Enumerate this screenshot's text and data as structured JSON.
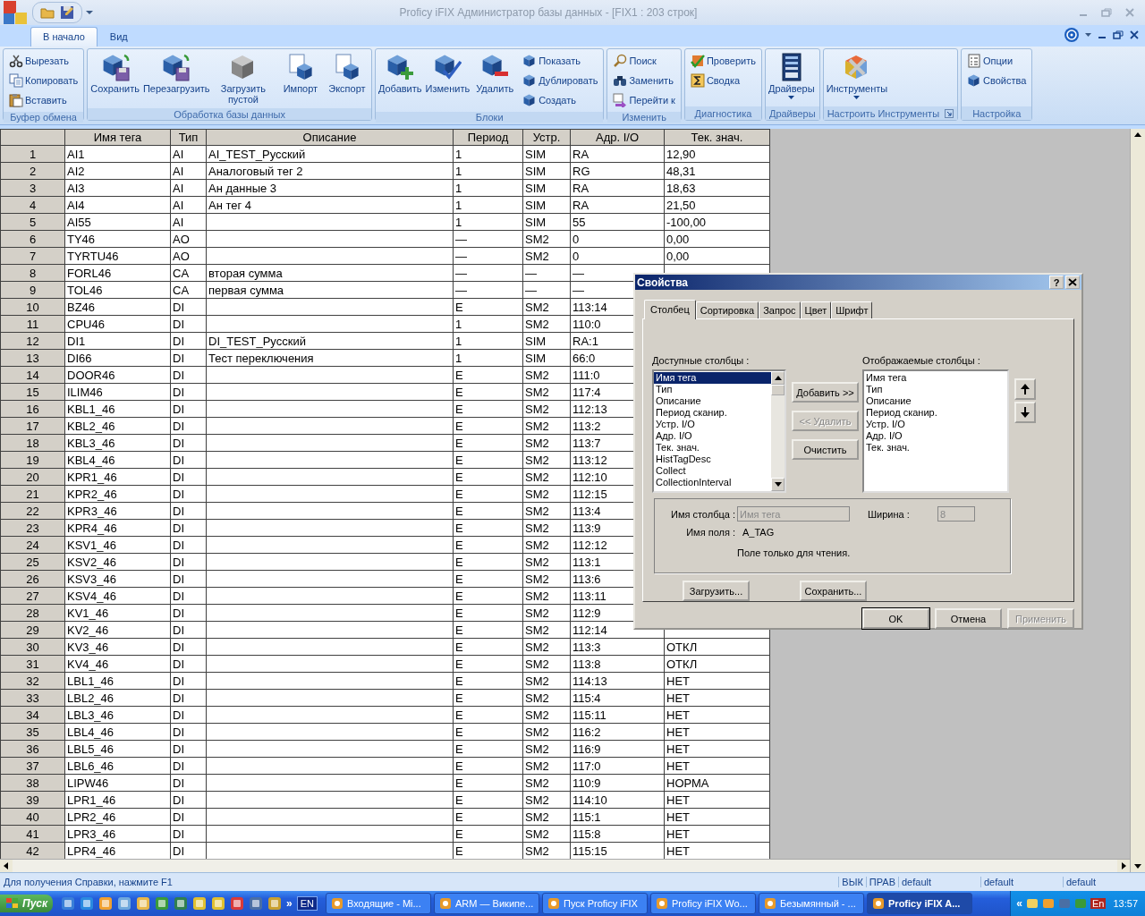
{
  "window": {
    "title": "Proficy iFIX Администратор базы данных - [FIX1 : 203 строк]"
  },
  "ribbon_tabs": [
    {
      "label": "В начало",
      "selected": true
    },
    {
      "label": "Вид",
      "selected": false
    }
  ],
  "ribbon": {
    "groups": [
      {
        "label": "Буфер обмена",
        "launcher": false,
        "items": [
          {
            "label": "Вырезать",
            "kind": "small"
          },
          {
            "label": "Копировать",
            "kind": "small"
          },
          {
            "label": "Вставить",
            "kind": "small"
          }
        ]
      },
      {
        "label": "Обработка базы данных",
        "launcher": false,
        "items": [
          {
            "label": "Сохранить",
            "kind": "large"
          },
          {
            "label": "Перезагрузить",
            "kind": "large"
          },
          {
            "label": "Загрузить пустой",
            "kind": "large"
          },
          {
            "label": "Импорт",
            "kind": "large"
          },
          {
            "label": "Экспорт",
            "kind": "large"
          }
        ]
      },
      {
        "label": "Блоки",
        "launcher": false,
        "items": [
          {
            "label": "Добавить",
            "kind": "large"
          },
          {
            "label": "Изменить",
            "kind": "large"
          },
          {
            "label": "Удалить",
            "kind": "large"
          },
          {
            "label": "Показать",
            "kind": "small"
          },
          {
            "label": "Дублировать",
            "kind": "small"
          },
          {
            "label": "Создать",
            "kind": "small"
          }
        ]
      },
      {
        "label": "Изменить",
        "launcher": false,
        "items": [
          {
            "label": "Поиск",
            "kind": "small"
          },
          {
            "label": "Заменить",
            "kind": "small"
          },
          {
            "label": "Перейти к",
            "kind": "small"
          }
        ]
      },
      {
        "label": "Диагностика",
        "launcher": false,
        "items": [
          {
            "label": "Проверить",
            "kind": "small"
          },
          {
            "label": "Сводка",
            "kind": "small"
          }
        ]
      },
      {
        "label": "Драйверы",
        "launcher": false,
        "items": [
          {
            "label": "Драйверы",
            "kind": "large_menu"
          }
        ]
      },
      {
        "label": "Настроить Инструменты",
        "launcher": true,
        "items": [
          {
            "label": "Инструменты",
            "kind": "large_menu"
          }
        ]
      },
      {
        "label": "Настройка",
        "launcher": false,
        "items": [
          {
            "label": "Опции",
            "kind": "small"
          },
          {
            "label": "Свойства",
            "kind": "small"
          }
        ]
      }
    ]
  },
  "table": {
    "columns": [
      "",
      "Имя тега",
      "Тип",
      "Описание",
      "Период",
      "Устр.",
      "Адр. I/O",
      "Тек. знач."
    ],
    "rows": [
      [
        "1",
        "AI1",
        "AI",
        "AI_TEST_Русский",
        "1",
        "SIM",
        "RA",
        "12,90"
      ],
      [
        "2",
        "AI2",
        "AI",
        "Аналоговый тег 2",
        "1",
        "SIM",
        "RG",
        "48,31"
      ],
      [
        "3",
        "AI3",
        "AI",
        "Ан данные 3",
        "1",
        "SIM",
        "RA",
        "18,63"
      ],
      [
        "4",
        "AI4",
        "AI",
        "Ан тег 4",
        "1",
        "SIM",
        "RA",
        "21,50"
      ],
      [
        "5",
        "AI55",
        "AI",
        "",
        "1",
        "SIM",
        "55",
        "-100,00"
      ],
      [
        "6",
        "TY46",
        "AO",
        "",
        "—",
        "SM2",
        "0",
        "0,00"
      ],
      [
        "7",
        "TYRTU46",
        "AO",
        "",
        "—",
        "SM2",
        "0",
        "0,00"
      ],
      [
        "8",
        "FORL46",
        "CA",
        "вторая сумма",
        "—",
        "—",
        "—"
      ],
      [
        "9",
        "TOL46",
        "CA",
        "первая сумма",
        "—",
        "—",
        "—"
      ],
      [
        "10",
        "BZ46",
        "DI",
        "",
        "E",
        "SM2",
        "113:14"
      ],
      [
        "11",
        "CPU46",
        "DI",
        "",
        "1",
        "SM2",
        "110:0"
      ],
      [
        "12",
        "DI1",
        "DI",
        "DI_TEST_Русский",
        "1",
        "SIM",
        "RA:1"
      ],
      [
        "13",
        "DI66",
        "DI",
        "Тест переключения",
        "1",
        "SIM",
        "66:0"
      ],
      [
        "14",
        "DOOR46",
        "DI",
        "",
        "E",
        "SM2",
        "111:0"
      ],
      [
        "15",
        "ILIM46",
        "DI",
        "",
        "E",
        "SM2",
        "117:4"
      ],
      [
        "16",
        "KBL1_46",
        "DI",
        "",
        "E",
        "SM2",
        "112:13"
      ],
      [
        "17",
        "KBL2_46",
        "DI",
        "",
        "E",
        "SM2",
        "113:2"
      ],
      [
        "18",
        "KBL3_46",
        "DI",
        "",
        "E",
        "SM2",
        "113:7"
      ],
      [
        "19",
        "KBL4_46",
        "DI",
        "",
        "E",
        "SM2",
        "113:12"
      ],
      [
        "20",
        "KPR1_46",
        "DI",
        "",
        "E",
        "SM2",
        "112:10"
      ],
      [
        "21",
        "KPR2_46",
        "DI",
        "",
        "E",
        "SM2",
        "112:15"
      ],
      [
        "22",
        "KPR3_46",
        "DI",
        "",
        "E",
        "SM2",
        "113:4"
      ],
      [
        "23",
        "KPR4_46",
        "DI",
        "",
        "E",
        "SM2",
        "113:9"
      ],
      [
        "24",
        "KSV1_46",
        "DI",
        "",
        "E",
        "SM2",
        "112:12"
      ],
      [
        "25",
        "KSV2_46",
        "DI",
        "",
        "E",
        "SM2",
        "113:1"
      ],
      [
        "26",
        "KSV3_46",
        "DI",
        "",
        "E",
        "SM2",
        "113:6"
      ],
      [
        "27",
        "KSV4_46",
        "DI",
        "",
        "E",
        "SM2",
        "113:11"
      ],
      [
        "28",
        "KV1_46",
        "DI",
        "",
        "E",
        "SM2",
        "112:9"
      ],
      [
        "29",
        "KV2_46",
        "DI",
        "",
        "E",
        "SM2",
        "112:14"
      ],
      [
        "30",
        "KV3_46",
        "DI",
        "",
        "E",
        "SM2",
        "113:3",
        "ОТКЛ"
      ],
      [
        "31",
        "KV4_46",
        "DI",
        "",
        "E",
        "SM2",
        "113:8",
        "ОТКЛ"
      ],
      [
        "32",
        "LBL1_46",
        "DI",
        "",
        "E",
        "SM2",
        "114:13",
        "НЕТ"
      ],
      [
        "33",
        "LBL2_46",
        "DI",
        "",
        "E",
        "SM2",
        "115:4",
        "НЕТ"
      ],
      [
        "34",
        "LBL3_46",
        "DI",
        "",
        "E",
        "SM2",
        "115:11",
        "НЕТ"
      ],
      [
        "35",
        "LBL4_46",
        "DI",
        "",
        "E",
        "SM2",
        "116:2",
        "НЕТ"
      ],
      [
        "36",
        "LBL5_46",
        "DI",
        "",
        "E",
        "SM2",
        "116:9",
        "НЕТ"
      ],
      [
        "37",
        "LBL6_46",
        "DI",
        "",
        "E",
        "SM2",
        "117:0",
        "НЕТ"
      ],
      [
        "38",
        "LIPW46",
        "DI",
        "",
        "E",
        "SM2",
        "110:9",
        "НОРМА"
      ],
      [
        "39",
        "LPR1_46",
        "DI",
        "",
        "E",
        "SM2",
        "114:10",
        "НЕТ"
      ],
      [
        "40",
        "LPR2_46",
        "DI",
        "",
        "E",
        "SM2",
        "115:1",
        "НЕТ"
      ],
      [
        "41",
        "LPR3_46",
        "DI",
        "",
        "E",
        "SM2",
        "115:8",
        "НЕТ"
      ],
      [
        "42",
        "LPR4_46",
        "DI",
        "",
        "E",
        "SM2",
        "115:15",
        "НЕТ"
      ]
    ]
  },
  "dialog": {
    "title": "Свойства",
    "help": "?",
    "tabs": [
      {
        "label": "Столбец",
        "selected": true
      },
      {
        "label": "Сортировка",
        "selected": false
      },
      {
        "label": "Запрос",
        "selected": false
      },
      {
        "label": "Цвет",
        "selected": false
      },
      {
        "label": "Шрифт",
        "selected": false
      }
    ],
    "available_label": "Доступные столбцы :",
    "available_items": [
      {
        "label": "Имя тега",
        "selected": true
      },
      {
        "label": "Тип",
        "selected": false
      },
      {
        "label": "Описание",
        "selected": false
      },
      {
        "label": "Период сканир.",
        "selected": false
      },
      {
        "label": "Устр. I/O",
        "selected": false
      },
      {
        "label": "Адр. I/O",
        "selected": false
      },
      {
        "label": "Тек. знач.",
        "selected": false
      },
      {
        "label": "HistTagDesc",
        "selected": false
      },
      {
        "label": "Collect",
        "selected": false
      },
      {
        "label": "CollectionInterval",
        "selected": false
      }
    ],
    "move_buttons": [
      {
        "label": "Добавить >>",
        "disabled": false
      },
      {
        "label": "<< Удалить",
        "disabled": true
      },
      {
        "label": "Очистить",
        "disabled": false
      }
    ],
    "displayed_label": "Отображаемые столбцы :",
    "displayed_items": [
      "Имя тега",
      "Тип",
      "Описание",
      "Период сканир.",
      "Устр. I/O",
      "Адр. I/O",
      "Тек. знач."
    ],
    "column_name_label": "Имя столбца :",
    "column_name_value": "Имя тега",
    "width_label": "Ширина :",
    "width_value": "8",
    "field_name_label": "Имя поля :",
    "field_name_value": "A_TAG",
    "note": "Поле только для чтения.",
    "file_buttons": [
      "Загрузить...",
      "Сохранить..."
    ],
    "footer_buttons": [
      {
        "label": "OK",
        "disabled": false
      },
      {
        "label": "Отмена",
        "disabled": false
      },
      {
        "label": "Применить",
        "disabled": true
      }
    ]
  },
  "status_bar": {
    "message": "Для получения Справки, нажмите F1",
    "panes": [
      "ВЫК",
      "ПРАВ",
      "default",
      "default",
      "default"
    ]
  },
  "taskbar": {
    "start": "Пуск",
    "more": "»",
    "language": "EN",
    "tasks": [
      {
        "label": "Входящие - Mi...",
        "selected": false
      },
      {
        "label": "ARM — Википе...",
        "selected": false
      },
      {
        "label": "Пуск Proficy iFIX",
        "selected": false
      },
      {
        "label": "Proficy iFIX Wo...",
        "selected": false
      },
      {
        "label": "Безымянный - ...",
        "selected": false
      },
      {
        "label": "Proficy iFIX A...",
        "selected": true
      }
    ],
    "tray_expand": "«",
    "tray_language": "En",
    "clock": "13:57"
  }
}
